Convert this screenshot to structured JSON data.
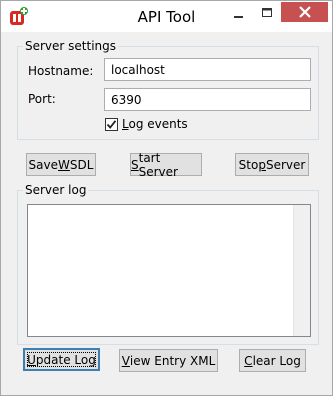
{
  "window": {
    "title": "API Tool",
    "app_icon": "app-logo-icon",
    "controls": {
      "minimize_icon": "minimize-icon",
      "maximize_icon": "maximize-icon",
      "close_icon": "close-icon"
    }
  },
  "server_settings": {
    "group_label": "Server settings",
    "hostname_label": "Hostname:",
    "hostname_value": "localhost",
    "port_label": "Port:",
    "port_value": "6390",
    "log_events": {
      "label_underlined": "L",
      "label_rest": "og events",
      "checked": true
    }
  },
  "actions": {
    "save_wsdl": {
      "pre": "Save ",
      "u": "W",
      "post": "SDL"
    },
    "start_server": {
      "pre": "",
      "u": "S",
      "post": "tart Server"
    },
    "stop_server": {
      "pre": "Sto",
      "u": "p",
      "post": " Server"
    }
  },
  "server_log": {
    "group_label": "Server log",
    "content": ""
  },
  "log_actions": {
    "update_log": {
      "pre": "",
      "u": "U",
      "post": "pdate Log"
    },
    "view_entry_xml": {
      "pre": "",
      "u": "V",
      "post": "iew Entry XML"
    },
    "clear_log": {
      "pre": "",
      "u": "C",
      "post": "lear Log"
    }
  },
  "colors": {
    "close_button_bg": "#c75050",
    "default_button_border": "#3c7fb1",
    "window_bg": "#f0f0f0"
  }
}
